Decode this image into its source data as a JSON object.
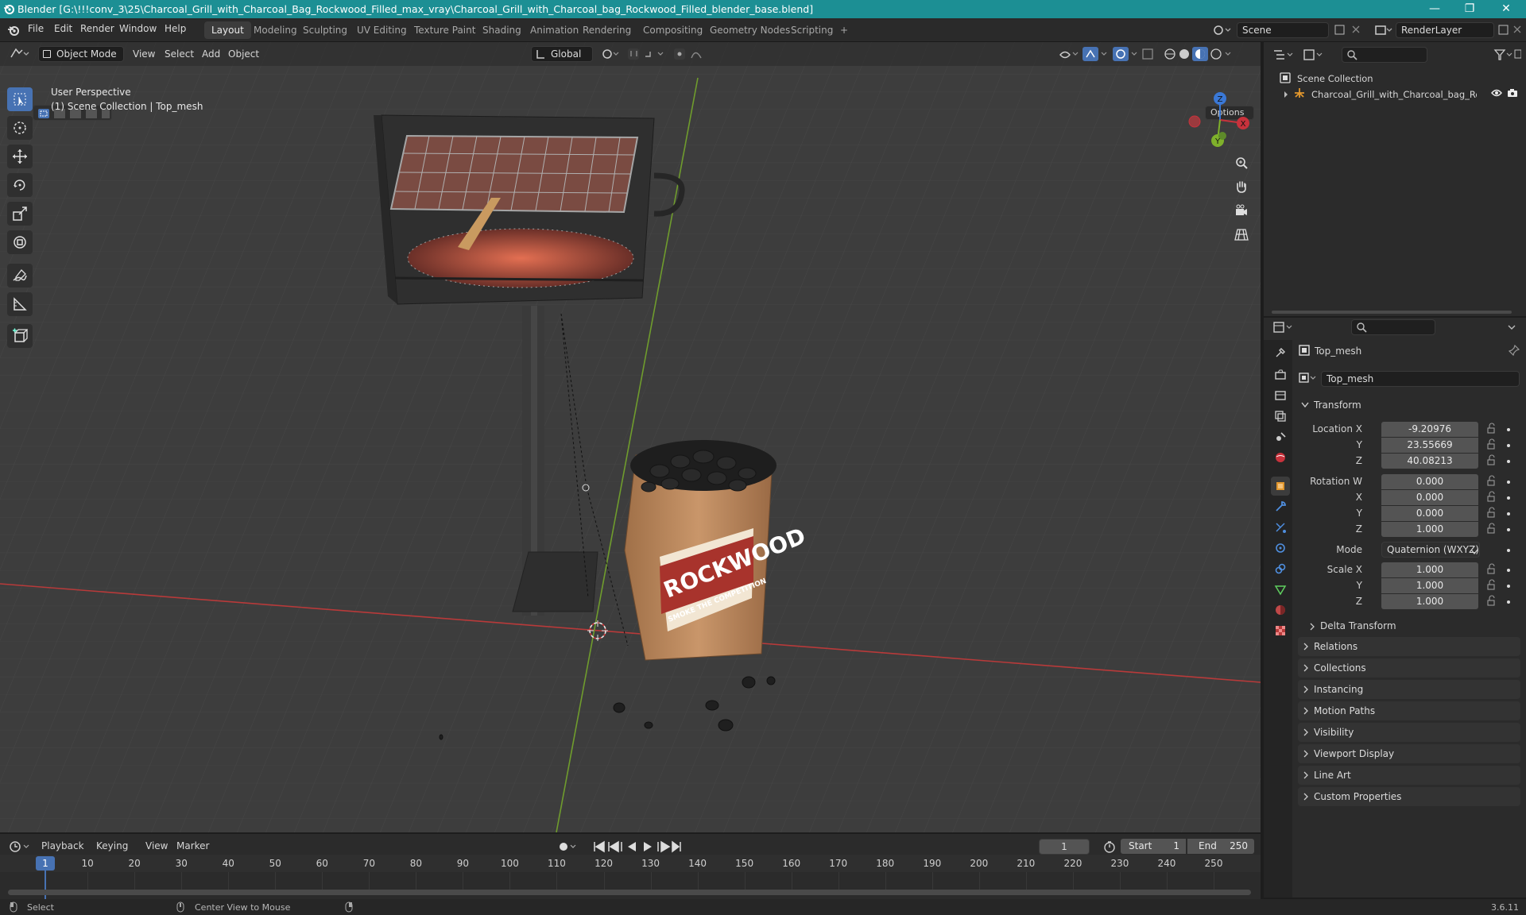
{
  "window": {
    "title": "Blender [G:\\!!!conv_3\\25\\Charcoal_Grill_with_Charcoal_Bag_Rockwood_Filled_max_vray\\Charcoal_Grill_with_Charcoal_bag_Rockwood_Filled_blender_base.blend]",
    "minimize": "—",
    "maximize": "❐",
    "close": "✕"
  },
  "menu": {
    "file": "File",
    "edit": "Edit",
    "render": "Render",
    "window": "Window",
    "help": "Help"
  },
  "workspaces": [
    "Layout",
    "Modeling",
    "Sculpting",
    "UV Editing",
    "Texture Paint",
    "Shading",
    "Animation",
    "Rendering",
    "Compositing",
    "Geometry Nodes",
    "Scripting",
    "+"
  ],
  "scene": {
    "name": "Scene",
    "render_layer": "RenderLayer"
  },
  "viewport": {
    "mode": "Object Mode",
    "menus": [
      "View",
      "Select",
      "Add",
      "Object"
    ],
    "orientation": "Global",
    "options": "Options",
    "perspective": "User Perspective",
    "collection_info": "(1) Scene Collection | Top_mesh",
    "bag_brand": "ROCKWOOD",
    "bag_tagline": "SMOKE THE COMPETITION",
    "gizmo": {
      "z": "Z",
      "x": "X",
      "y": "Y"
    }
  },
  "outliner": {
    "root": "Scene Collection",
    "items": [
      {
        "name": "Charcoal_Grill_with_Charcoal_bag_Rock"
      }
    ]
  },
  "properties": {
    "object_name": "Top_mesh",
    "mesh_name": "Top_mesh",
    "transform_header": "Transform",
    "location_label": "Location X",
    "location": {
      "x": "-9.20976",
      "y": "23.55669",
      "z": "40.08213"
    },
    "rotation_label": "Rotation W",
    "rotation": {
      "w": "0.000",
      "x": "0.000",
      "y": "0.000",
      "z": "1.000"
    },
    "mode_label": "Mode",
    "mode": "Quaternion (WXYZ)",
    "scale_label": "Scale X",
    "scale": {
      "x": "1.000",
      "y": "1.000",
      "z": "1.000"
    },
    "axis": {
      "x": "X",
      "y": "Y",
      "z": "Z"
    },
    "delta": "Delta Transform",
    "panels": [
      "Relations",
      "Collections",
      "Instancing",
      "Motion Paths",
      "Visibility",
      "Viewport Display",
      "Line Art",
      "Custom Properties"
    ]
  },
  "timeline": {
    "menus": [
      "Playback",
      "Keying",
      "View",
      "Marker"
    ],
    "current_frame": "1",
    "start_label": "Start",
    "start": "1",
    "end_label": "End",
    "end": "250",
    "ticks": [
      "1",
      "10",
      "20",
      "30",
      "40",
      "50",
      "60",
      "70",
      "80",
      "90",
      "100",
      "110",
      "120",
      "130",
      "140",
      "150",
      "160",
      "170",
      "180",
      "190",
      "200",
      "210",
      "220",
      "230",
      "240",
      "250"
    ]
  },
  "status": {
    "select": "Select",
    "center": "Center View to Mouse",
    "version": "3.6.11"
  },
  "colors": {
    "titlebar": "#1c8f94",
    "accent": "#4772b3",
    "x_axis": "#c8323c",
    "y_axis": "#7fb12b",
    "z_axis": "#3a78d6"
  }
}
